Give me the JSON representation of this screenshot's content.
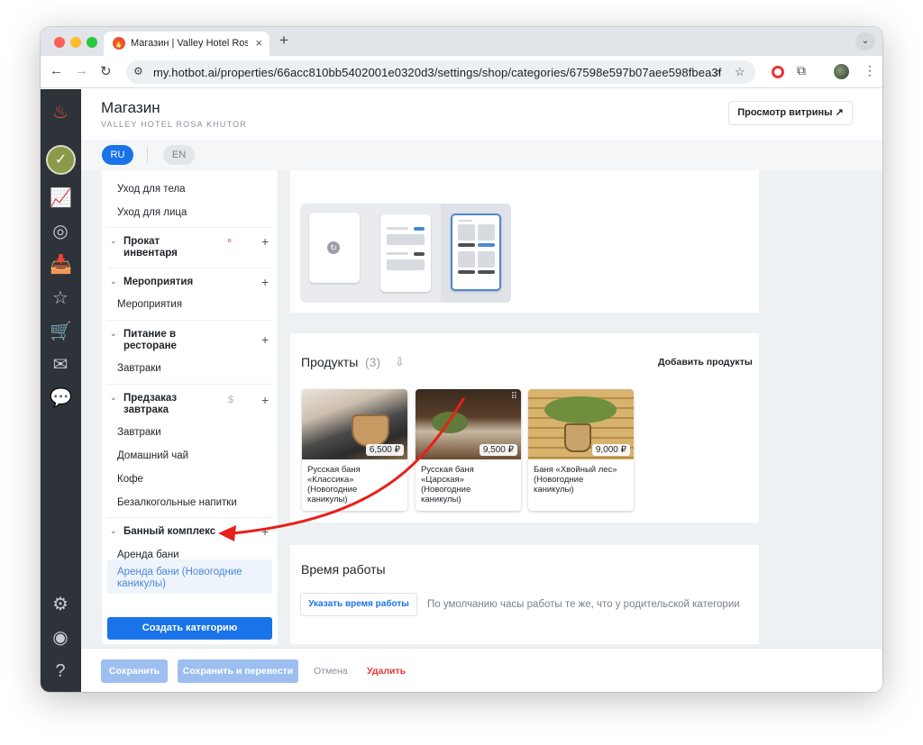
{
  "browser": {
    "tab_title": "Магазин | Valley Hotel Rosa K",
    "tab_close": "×",
    "new_tab": "+",
    "tab_menu": "⌄",
    "url": "my.hotbot.ai/properties/66acc810bb5402001e0320d3/settings/shop/categories/67598e597b07aee598fbea3f"
  },
  "header": {
    "title": "Магазин",
    "subtitle": "VALLEY HOTEL ROSA KHUTOR",
    "preview_button": "Просмотр витрины ↗"
  },
  "languages": {
    "active": "RU",
    "other": "EN"
  },
  "sidebar": {
    "items_top": [
      "Уход для тела",
      "Уход для лица"
    ],
    "groups": {
      "rental": {
        "label_line1": "Прокат",
        "label_line2": "инвентаря",
        "badge": "⏸",
        "items": []
      },
      "events": {
        "label": "Мероприятия",
        "items": [
          "Мероприятия"
        ]
      },
      "restaurant": {
        "label_line1": "Питание в",
        "label_line2": "ресторане",
        "items": [
          "Завтраки"
        ]
      },
      "preorder": {
        "label_line1": "Предзаказ",
        "label_line2": "завтрака",
        "badge": "$",
        "items": [
          "Завтраки",
          "Домашний чай",
          "Кофе",
          "Безалкогольные напитки"
        ]
      },
      "bath": {
        "label": "Банный комплекс",
        "items": [
          "Аренда бани"
        ],
        "selected_line1": "Аренда бани (Новогодние",
        "selected_line2": "каникулы)"
      }
    },
    "create_button": "Создать категорию"
  },
  "products": {
    "title": "Продукты",
    "count": "(3)",
    "add_button": "Добавить продукты",
    "items": [
      {
        "name": "Русская баня\n«Классика»\n(Новогодние\nканикулы)",
        "price": "6,500 ₽"
      },
      {
        "name": "Русская баня\n«Царская»\n(Новогодние\nканикулы)",
        "price": "9,500 ₽"
      },
      {
        "name": "Баня «Хвойный лес»\n(Новогодние\nканикулы)",
        "price": "9,000 ₽"
      }
    ]
  },
  "hours": {
    "title": "Время работы",
    "button": "Указать время работы",
    "note": "По умолчанию часы работы те же, что у родительской категории"
  },
  "footer": {
    "save": "Сохранить",
    "save_translate": "Сохранить и перевести",
    "cancel": "Отмена",
    "delete": "Удалить"
  },
  "colors": {
    "accent": "#1a73e8",
    "danger": "#e53935",
    "annotation_arrow": "#e8201a",
    "rail": "#2e3239"
  }
}
